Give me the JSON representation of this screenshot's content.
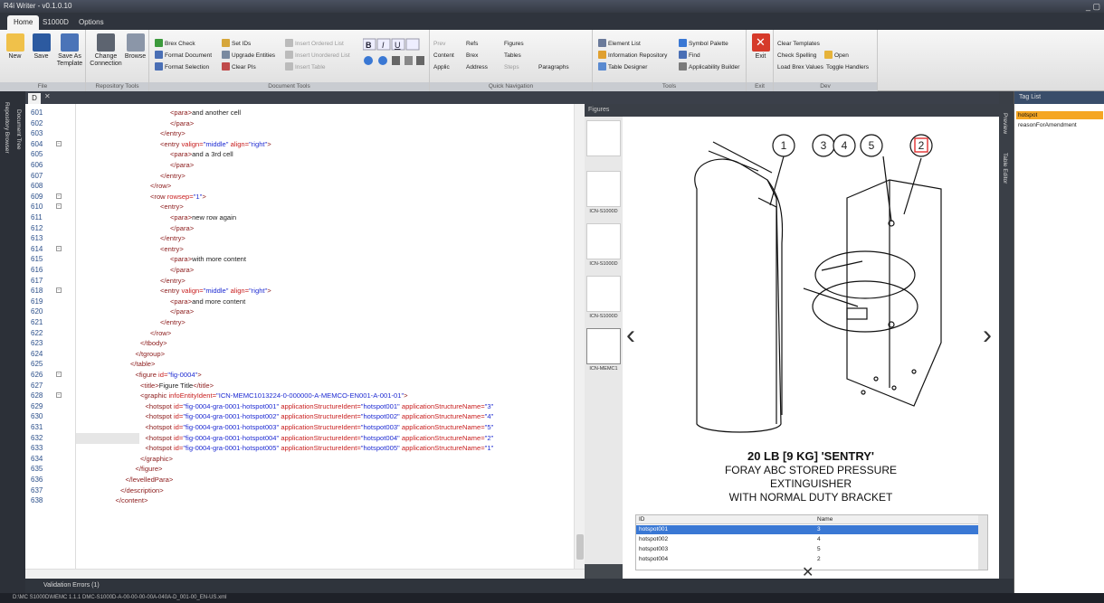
{
  "window": {
    "title": "R4i Writer - v0.1.0.10",
    "controls": "_ ▢"
  },
  "tabs": [
    {
      "label": "Home"
    },
    {
      "label": "S1000D"
    },
    {
      "label": "Options"
    }
  ],
  "ribbon": {
    "file": {
      "new": "New",
      "save": "Save",
      "save_as": "Save As Template",
      "label": "File"
    },
    "repo": {
      "change": "Change Connection",
      "browse": "Browse",
      "label": "Repository Tools"
    },
    "doc": {
      "brex_check": "Brex Check",
      "set_ids": "Set IDs",
      "insert_ordered": "Insert Ordered List",
      "format_document": "Format Document",
      "upgrade_entities": "Upgrade Entities",
      "insert_unordered": "Insert Unordered List",
      "format_selection": "Format Selection",
      "clear_pis": "Clear PIs",
      "insert_table": "Insert Table",
      "label": "Document Tools"
    },
    "nav": {
      "prev": "Prev",
      "refs": "Refs",
      "figures": "Figures",
      "content": "Content",
      "brex": "Brex",
      "tables": "Tables",
      "applic": "Applic",
      "address": "Address",
      "steps": "Steps",
      "paragraphs": "Paragraphs",
      "label": "Quick Navigation"
    },
    "tools": {
      "element_list": "Element List",
      "symbol_palette": "Symbol Palette",
      "info_repo": "Information Repository",
      "find": "Find",
      "table_designer": "Table Designer",
      "applic_builder": "Applicability Builder",
      "label": "Tools"
    },
    "exit": {
      "label": "Exit",
      "group": "Exit"
    },
    "dev": {
      "clear_templates": "Clear Templates",
      "check_spelling": "Check Spelling",
      "open": "Open",
      "load_brex": "Load Brex Values",
      "toggle_handlers": "Toggle Handlers",
      "label": "Dev"
    }
  },
  "left_tabs": [
    "Repository Browser",
    "Document Tree"
  ],
  "editor": {
    "tab": "D",
    "lines": [
      {
        "n": "601",
        "html": "<span class='t'>&lt;para&gt;</span><span class='tx'>and another cell</span>",
        "i": 4
      },
      {
        "n": "602",
        "html": "<span class='t'>&lt;/para&gt;</span>",
        "i": 4
      },
      {
        "n": "603",
        "html": "<span class='t'>&lt;/entry&gt;</span>",
        "i": 3
      },
      {
        "n": "604",
        "html": "<span class='t'>&lt;entry </span><span class='a'>valign=</span><span class='v'>\"middle\"</span><span class='a'> align=</span><span class='v'>\"right\"</span><span class='t'>&gt;</span>",
        "i": 3,
        "f": true
      },
      {
        "n": "605",
        "html": "<span class='t'>&lt;para&gt;</span><span class='tx'>and a 3rd cell</span>",
        "i": 4
      },
      {
        "n": "606",
        "html": "<span class='t'>&lt;/para&gt;</span>",
        "i": 4
      },
      {
        "n": "607",
        "html": "<span class='t'>&lt;/entry&gt;</span>",
        "i": 3
      },
      {
        "n": "608",
        "html": "<span class='t'>&lt;/row&gt;</span>",
        "i": 2
      },
      {
        "n": "609",
        "html": "<span class='t'>&lt;row </span><span class='a'>rowsep=</span><span class='v'>\"1\"</span><span class='t'>&gt;</span>",
        "i": 2,
        "f": true
      },
      {
        "n": "610",
        "html": "<span class='t'>&lt;entry&gt;</span>",
        "i": 3,
        "f": true
      },
      {
        "n": "611",
        "html": "<span class='t'>&lt;para&gt;</span><span class='tx'>new row again</span>",
        "i": 4
      },
      {
        "n": "612",
        "html": "<span class='t'>&lt;/para&gt;</span>",
        "i": 4
      },
      {
        "n": "613",
        "html": "<span class='t'>&lt;/entry&gt;</span>",
        "i": 3
      },
      {
        "n": "614",
        "html": "<span class='t'>&lt;entry&gt;</span>",
        "i": 3,
        "f": true
      },
      {
        "n": "615",
        "html": "<span class='t'>&lt;para&gt;</span><span class='tx'>with more content</span>",
        "i": 4
      },
      {
        "n": "616",
        "html": "<span class='t'>&lt;/para&gt;</span>",
        "i": 4
      },
      {
        "n": "617",
        "html": "<span class='t'>&lt;/entry&gt;</span>",
        "i": 3
      },
      {
        "n": "618",
        "html": "<span class='t'>&lt;entry </span><span class='a'>valign=</span><span class='v'>\"middle\"</span><span class='a'> align=</span><span class='v'>\"right\"</span><span class='t'>&gt;</span>",
        "i": 3,
        "f": true
      },
      {
        "n": "619",
        "html": "<span class='t'>&lt;para&gt;</span><span class='tx'>and more content</span>",
        "i": 4
      },
      {
        "n": "620",
        "html": "<span class='t'>&lt;/para&gt;</span>",
        "i": 4
      },
      {
        "n": "621",
        "html": "<span class='t'>&lt;/entry&gt;</span>",
        "i": 3
      },
      {
        "n": "622",
        "html": "<span class='t'>&lt;/row&gt;</span>",
        "i": 2
      },
      {
        "n": "623",
        "html": "<span class='t'>&lt;/tbody&gt;</span>",
        "i": 1
      },
      {
        "n": "624",
        "html": "<span class='t'>&lt;/tgroup&gt;</span>",
        "i": 0.5
      },
      {
        "n": "625",
        "html": "<span class='t'>&lt;/table&gt;</span>",
        "i": 0
      },
      {
        "n": "626",
        "html": "<span class='t'>&lt;figure </span><span class='a'>id=</span><span class='v'>\"fig-0004\"</span><span class='t'>&gt;</span>",
        "i": 0.5,
        "f": true
      },
      {
        "n": "627",
        "html": "<span class='t'>&lt;title&gt;</span><span class='tx'>Figure Title</span><span class='t'>&lt;/title&gt;</span>",
        "i": 1
      },
      {
        "n": "628",
        "html": "<span class='t'>&lt;graphic </span><span class='a'>infoEntityIdent=</span><span class='v'>\"ICN-MEMC1013224-0-000000-A-MEMCO-EN001-A-001-01\"</span><span class='t'>&gt;</span>",
        "i": 1,
        "f": true
      },
      {
        "n": "629",
        "html": "<span class='t'>&lt;hotspot </span><span class='a'>id=</span><span class='v'>\"fig-0004-gra-0001-hotspot001\"</span><span class='a'> applicationStructureIdent=</span><span class='v'>\"hotspot001\"</span><span class='a'> applicationStructureName=</span><span class='v'>\"3\"</span>",
        "i": 1.5
      },
      {
        "n": "630",
        "html": "<span class='t'>&lt;hotspot </span><span class='a'>id=</span><span class='v'>\"fig-0004-gra-0001-hotspot002\"</span><span class='a'> applicationStructureIdent=</span><span class='v'>\"hotspot002\"</span><span class='a'> applicationStructureName=</span><span class='v'>\"4\"</span>",
        "i": 1.5
      },
      {
        "n": "631",
        "html": "<span class='t'>&lt;hotspot </span><span class='a'>id=</span><span class='v'>\"fig-0004-gra-0001-hotspot003\"</span><span class='a'> applicationStructureIdent=</span><span class='v'>\"hotspot003\"</span><span class='a'> applicationStructureName=</span><span class='v'>\"5\"</span>",
        "i": 1.5
      },
      {
        "n": "632",
        "html": "<span class='t'>&lt;hotspot </span><span class='a'>id=</span><span class='v'>\"fig-0004-gra-0001-hotspot004\"</span><span class='a'> applicationStructureIdent=</span><span class='v'>\"hotspot004\"</span><span class='a'> applicationStructureName=</span><span class='v'>\"2\"</span>",
        "i": 1.5,
        "cur": true
      },
      {
        "n": "633",
        "html": "<span class='t'>&lt;hotspot </span><span class='a'>id=</span><span class='v'>\"fig-0004-gra-0001-hotspot005\"</span><span class='a'> applicationStructureIdent=</span><span class='v'>\"hotspot005\"</span><span class='a'> applicationStructureName=</span><span class='v'>\"1\"</span>",
        "i": 1.5
      },
      {
        "n": "634",
        "html": "<span class='t'>&lt;/graphic&gt;</span>",
        "i": 1
      },
      {
        "n": "635",
        "html": "<span class='t'>&lt;/figure&gt;</span>",
        "i": 0.5
      },
      {
        "n": "636",
        "html": "<span class='t'>&lt;/levelledPara&gt;</span>",
        "i": -0.5
      },
      {
        "n": "637",
        "html": "<span class='t'>&lt;/description&gt;</span>",
        "i": -1
      },
      {
        "n": "638",
        "html": "<span class='t'>&lt;/content&gt;</span>",
        "i": -1.5
      }
    ]
  },
  "figures": {
    "header": "Figures",
    "thumb_captions": [
      "ICN-S1000D",
      "ICN-S1000D",
      "ICN-S1000D",
      "ICN-MEMC1"
    ],
    "callouts": [
      "1",
      "3",
      "4",
      "5",
      "2"
    ],
    "caption": [
      "20 LB [9 KG] 'SENTRY'",
      "FORAY ABC STORED PRESSURE",
      "EXTINGUISHER",
      "WITH NORMAL DUTY BRACKET"
    ],
    "table_headers": [
      "ID",
      "Name"
    ],
    "hotspots": [
      {
        "id": "hotspot001",
        "name": "3"
      },
      {
        "id": "hotspot002",
        "name": "4"
      },
      {
        "id": "hotspot003",
        "name": "5"
      },
      {
        "id": "hotspot004",
        "name": "2"
      }
    ],
    "close": "✕",
    "nav_prev": "‹",
    "nav_next": "›"
  },
  "right_tabs": [
    "Preview",
    "Table Editor"
  ],
  "tag_list": {
    "header": "Tag List",
    "items": [
      "hotspot",
      "reasonForAmendment"
    ],
    "selected_color": "#f5a623"
  },
  "validation": {
    "label": "Validation Errors (1)"
  },
  "status": {
    "text": "D:\\MC S1000D\\MEMC 1.1.1 DMC-S1000D-A-00-00-00-00A-040A-D_001-00_EN-US.xml"
  },
  "colors": {
    "accent": "#3a78d4",
    "exit_red": "#d63a2a"
  }
}
